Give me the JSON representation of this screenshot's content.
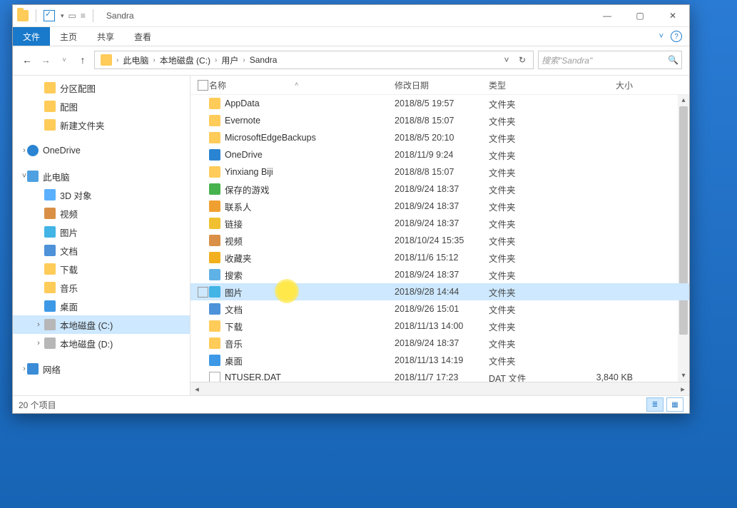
{
  "window_title": "Sandra",
  "ribbon": {
    "file": "文件",
    "tabs": [
      "主页",
      "共享",
      "查看"
    ]
  },
  "address": {
    "parts": [
      "此电脑",
      "本地磁盘 (C:)",
      "用户",
      "Sandra"
    ]
  },
  "search_placeholder": "搜索\"Sandra\"",
  "columns": {
    "name": "名称",
    "date": "修改日期",
    "type": "类型",
    "size": "大小"
  },
  "navpane": {
    "quick": [
      {
        "label": "分区配图",
        "icon": "ic-folder"
      },
      {
        "label": "配图",
        "icon": "ic-folder"
      },
      {
        "label": "新建文件夹",
        "icon": "ic-folder"
      }
    ],
    "onedrive": "OneDrive",
    "thispc": "此电脑",
    "pcchildren": [
      {
        "label": "3D 对象",
        "icon": "ic-3d"
      },
      {
        "label": "视频",
        "icon": "ic-vid"
      },
      {
        "label": "图片",
        "icon": "ic-pic"
      },
      {
        "label": "文档",
        "icon": "ic-doc"
      },
      {
        "label": "下载",
        "icon": "ic-dl"
      },
      {
        "label": "音乐",
        "icon": "ic-music"
      },
      {
        "label": "桌面",
        "icon": "ic-desktop"
      },
      {
        "label": "本地磁盘 (C:)",
        "icon": "ic-disk",
        "selected": true
      },
      {
        "label": "本地磁盘 (D:)",
        "icon": "ic-disk"
      }
    ],
    "network": "网络"
  },
  "files": [
    {
      "name": "AppData",
      "date": "2018/8/5 19:57",
      "type": "文件夹",
      "size": "",
      "icon": "ic-f"
    },
    {
      "name": "Evernote",
      "date": "2018/8/8 15:07",
      "type": "文件夹",
      "size": "",
      "icon": "ic-f"
    },
    {
      "name": "MicrosoftEdgeBackups",
      "date": "2018/8/5 20:10",
      "type": "文件夹",
      "size": "",
      "icon": "ic-f"
    },
    {
      "name": "OneDrive",
      "date": "2018/11/9 9:24",
      "type": "文件夹",
      "size": "",
      "icon": "ic-od"
    },
    {
      "name": "Yinxiang Biji",
      "date": "2018/8/8 15:07",
      "type": "文件夹",
      "size": "",
      "icon": "ic-f"
    },
    {
      "name": "保存的游戏",
      "date": "2018/9/24 18:37",
      "type": "文件夹",
      "size": "",
      "icon": "ic-game"
    },
    {
      "name": "联系人",
      "date": "2018/9/24 18:37",
      "type": "文件夹",
      "size": "",
      "icon": "ic-contact"
    },
    {
      "name": "链接",
      "date": "2018/9/24 18:37",
      "type": "文件夹",
      "size": "",
      "icon": "ic-link"
    },
    {
      "name": "视频",
      "date": "2018/10/24 15:35",
      "type": "文件夹",
      "size": "",
      "icon": "ic-video"
    },
    {
      "name": "收藏夹",
      "date": "2018/11/6 15:12",
      "type": "文件夹",
      "size": "",
      "icon": "ic-star"
    },
    {
      "name": "搜索",
      "date": "2018/9/24 18:37",
      "type": "文件夹",
      "size": "",
      "icon": "ic-srch"
    },
    {
      "name": "图片",
      "date": "2018/9/28 14:44",
      "type": "文件夹",
      "size": "",
      "icon": "ic-image",
      "selected": true,
      "spot": true
    },
    {
      "name": "文档",
      "date": "2018/9/26 15:01",
      "type": "文件夹",
      "size": "",
      "icon": "ic-docx"
    },
    {
      "name": "下载",
      "date": "2018/11/13 14:00",
      "type": "文件夹",
      "size": "",
      "icon": "ic-f"
    },
    {
      "name": "音乐",
      "date": "2018/9/24 18:37",
      "type": "文件夹",
      "size": "",
      "icon": "ic-mus"
    },
    {
      "name": "桌面",
      "date": "2018/11/13 14:19",
      "type": "文件夹",
      "size": "",
      "icon": "ic-dtop"
    },
    {
      "name": "NTUSER.DAT",
      "date": "2018/11/7 17:23",
      "type": "DAT 文件",
      "size": "3,840 KB",
      "icon": "ic-file"
    }
  ],
  "status_text": "20 个项目"
}
